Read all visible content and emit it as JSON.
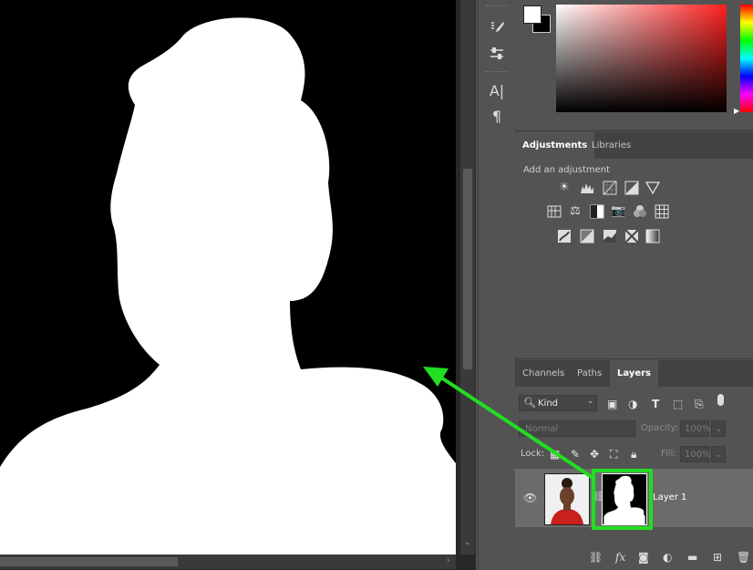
{
  "tools": {
    "brush_settings_icon": "brush-settings-icon",
    "properties_icon": "properties-icon",
    "character_label": "A|",
    "paragraph_label": "¶"
  },
  "adjustments": {
    "tabs": [
      {
        "label": "Adjustments",
        "active": true
      },
      {
        "label": "Libraries",
        "active": false
      }
    ],
    "hint": "Add an adjustment",
    "rows": [
      [
        "brightness-contrast-icon",
        "levels-icon",
        "curves-icon",
        "exposure-icon",
        "triangle-gradient-icon"
      ],
      [
        "vibrance-icon",
        "color-balance-icon",
        "black-white-icon",
        "photo-filter-icon",
        "channel-mixer-icon",
        "color-lookup-icon"
      ],
      [
        "invert-icon",
        "posterize-icon",
        "threshold-icon",
        "selective-color-icon",
        "gradient-map-icon"
      ]
    ]
  },
  "layers": {
    "tabs": [
      {
        "label": "Channels",
        "active": false
      },
      {
        "label": "Paths",
        "active": false
      },
      {
        "label": "Layers",
        "active": true
      }
    ],
    "filter_kind": "Kind",
    "blend_mode": "Normal",
    "opacity_label": "Opacity:",
    "opacity_value": "100%",
    "lock_label": "Lock:",
    "fill_label": "Fill:",
    "fill_value": "100%",
    "layer_name": "Layer 1",
    "accent": "#22dd22"
  }
}
